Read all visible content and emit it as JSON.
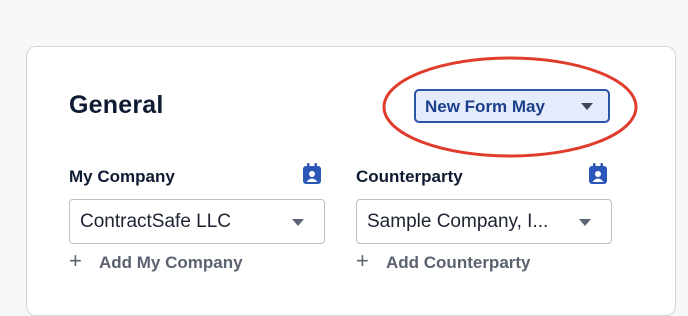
{
  "section": {
    "title": "General"
  },
  "form_selector": {
    "value": "New Form May"
  },
  "fields": [
    {
      "label": "My Company",
      "icon": "calendar-user-icon",
      "value": "ContractSafe LLC",
      "add_label": "Add My Company"
    },
    {
      "label": "Counterparty",
      "icon": "calendar-user-icon",
      "value": "Sample Company, I...",
      "add_label": "Add Counterparty"
    }
  ],
  "colors": {
    "accent": "#2a55a8",
    "selector_bg": "#e4ebfb",
    "annotation": "#e03c2b",
    "icon": "#2b58b8"
  }
}
